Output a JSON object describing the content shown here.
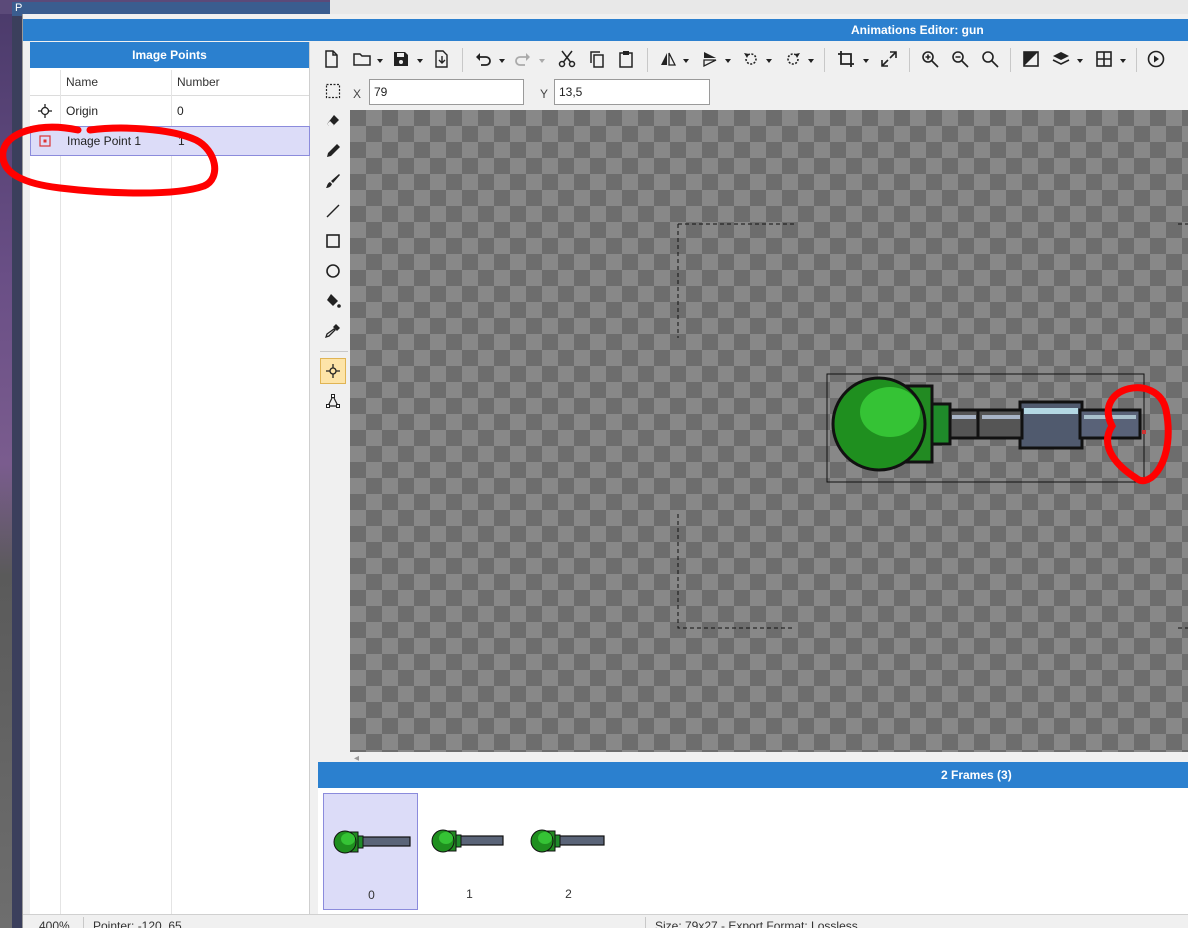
{
  "background": {
    "left_tab_label": "P"
  },
  "window": {
    "title": "Animations Editor: gun"
  },
  "points_panel": {
    "title": "Image Points",
    "columns": {
      "name": "Name",
      "number": "Number"
    },
    "rows": [
      {
        "name": "Origin",
        "number": "0",
        "icon": "crosshair-icon",
        "selected": false
      },
      {
        "name": "Image Point 1",
        "number": "1",
        "icon": "image-point-icon",
        "selected": true
      }
    ]
  },
  "toolbar": {
    "icons": [
      "new-file-icon",
      "open-folder-icon",
      "save-icon",
      "export-icon",
      "undo-icon",
      "redo-icon",
      "cut-icon",
      "copy-icon",
      "paste-icon",
      "flip-horizontal-icon",
      "flip-vertical-icon",
      "rotate-ccw-icon",
      "rotate-cw-icon",
      "crop-icon",
      "resize-icon",
      "zoom-in-icon",
      "zoom-out-icon",
      "zoom-reset-icon",
      "color-icon",
      "layers-icon",
      "grid-icon",
      "play-icon"
    ]
  },
  "coords": {
    "x_label": "X",
    "x_value": "79",
    "y_label": "Y",
    "y_value": "13,5"
  },
  "tools": [
    "select-rect-icon",
    "eraser-icon",
    "pencil-icon",
    "brush-icon",
    "line-icon",
    "rectangle-icon",
    "ellipse-icon",
    "fill-bucket-icon",
    "eyedropper-icon",
    "point-tool-icon",
    "polygon-tool-icon"
  ],
  "frames_panel": {
    "title": "2 Frames (3)",
    "frames": [
      {
        "label": "0",
        "selected": true
      },
      {
        "label": "1",
        "selected": false
      },
      {
        "label": "2",
        "selected": false
      }
    ]
  },
  "status": {
    "zoom": "400%",
    "pointer": "Pointer: -120, 65",
    "size_format": "Size: 79x27 - Export Format: Lossless"
  },
  "colors": {
    "accent": "#2b80cf",
    "annotation": "#ff0000",
    "gun_green": "#2ea82e",
    "selection": "#dcdcf8"
  }
}
